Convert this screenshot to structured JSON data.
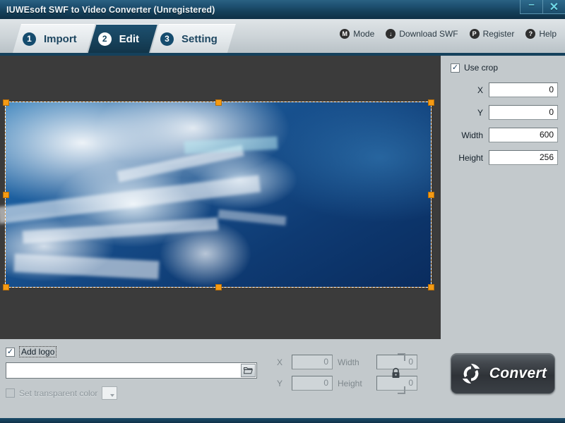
{
  "window": {
    "title": "IUWEsoft SWF to Video Converter (Unregistered)",
    "minimize_label": "–",
    "close_label": "✕"
  },
  "tabs": [
    {
      "num": "1",
      "label": "Import",
      "active": false
    },
    {
      "num": "2",
      "label": "Edit",
      "active": true
    },
    {
      "num": "3",
      "label": "Setting",
      "active": false
    }
  ],
  "toolbar": [
    {
      "icon": "mode-icon",
      "glyph": "M",
      "label": "Mode"
    },
    {
      "icon": "download-icon",
      "glyph": "↓",
      "label": "Download SWF"
    },
    {
      "icon": "register-icon",
      "glyph": "P",
      "label": "Register"
    },
    {
      "icon": "help-icon",
      "glyph": "?",
      "label": "Help"
    }
  ],
  "crop_panel": {
    "use_crop_label": "Use crop",
    "use_crop_checked": true,
    "check_glyph": "✓",
    "fields": [
      {
        "label": "X",
        "value": "0"
      },
      {
        "label": "Y",
        "value": "0"
      },
      {
        "label": "Width",
        "value": "600"
      },
      {
        "label": "Height",
        "value": "256"
      }
    ]
  },
  "logo_panel": {
    "add_logo_label": "Add logo",
    "add_logo_checked": true,
    "check_glyph": "✓",
    "logo_path_value": "",
    "logo_path_placeholder": "",
    "browse_icon": "folder-open-icon",
    "transparent_label": "Set transparent color",
    "transparent_checked": false,
    "position_fields": [
      {
        "label": "X",
        "value": "0"
      },
      {
        "label": "Width",
        "value": "0"
      },
      {
        "label": "Y",
        "value": "0"
      },
      {
        "label": "Height",
        "value": "0"
      }
    ],
    "lock_icon": "lock-icon"
  },
  "convert": {
    "label": "Convert",
    "icon": "refresh-icon"
  },
  "colors": {
    "titlebar": "#154059",
    "tab_active": "#17425c",
    "panel": "#c3c9cc",
    "canvas": "#3b3b3b",
    "handle": "#f59b14",
    "accent": "#6fd8e8"
  }
}
